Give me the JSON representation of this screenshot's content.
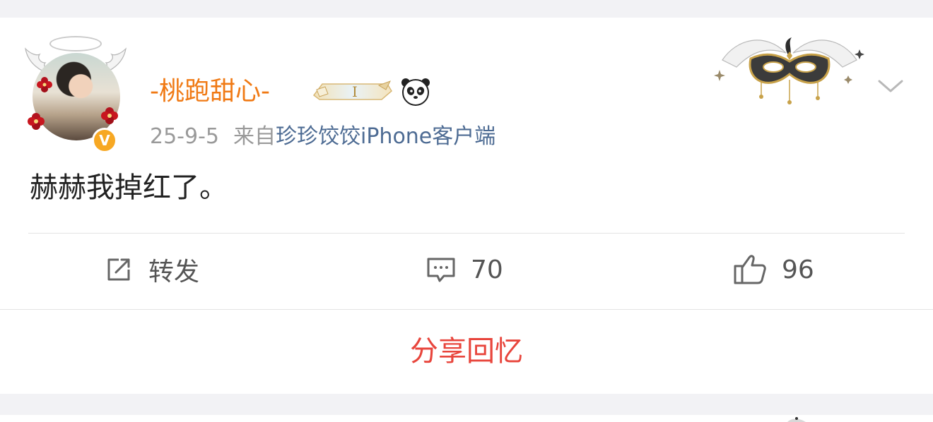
{
  "post": {
    "username": "-桃跑甜心-",
    "date": "25-9-5",
    "from_label": "来自",
    "source": "珍珍饺饺iPhone客户端",
    "text": "赫赫我掉红了。",
    "verified_badge": "V"
  },
  "icons": {
    "vip_badge": "vip-level-badge-icon",
    "panda": "panda-icon",
    "mask_decoration": "masquerade-mask-icon",
    "more": "chevron-down-icon",
    "repost": "repost-icon",
    "comment": "comment-icon",
    "like": "thumbs-up-icon"
  },
  "vip_badge_text": "I",
  "actions": {
    "repost_label": "转发",
    "comment_count": "70",
    "like_count": "96"
  },
  "footer": {
    "share_memory_label": "分享回忆"
  },
  "colors": {
    "username": "#f07a15",
    "source_link": "#4d6b93",
    "share_memory": "#e8453c",
    "page_background": "#f2f2f5",
    "verified_badge": "#f7a823"
  }
}
